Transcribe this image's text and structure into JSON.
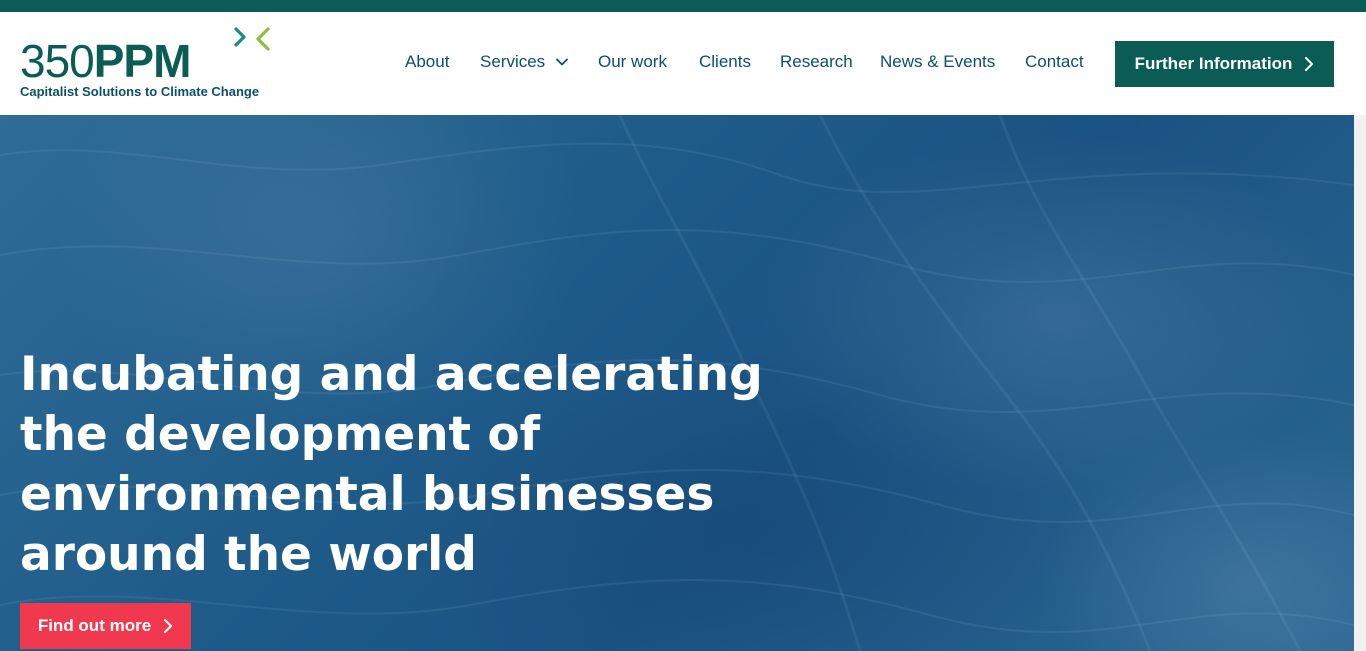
{
  "brand": {
    "logo_number": "350",
    "logo_letters": "PPM",
    "tagline": "Capitalist Solutions to Climate Change",
    "colors": {
      "primary": "#0b5c55",
      "accent_green": "#8cbf3f",
      "accent_teal": "#1c8a86",
      "nav_text": "#0b4f6c",
      "cta_red": "#f0394f"
    }
  },
  "nav": {
    "items": [
      {
        "label": "About"
      },
      {
        "label": "Services",
        "icon": "chevron-down-icon"
      },
      {
        "label": "Our work"
      },
      {
        "label": "Clients"
      },
      {
        "label": "Research"
      },
      {
        "label": "News & Events"
      },
      {
        "label": "Contact"
      }
    ],
    "cta_label": "Further Information",
    "cta_icon": "chevron-right-icon"
  },
  "hero": {
    "heading": "Incubating and accelerating the development of environmental businesses around the world",
    "cta_label": "Find out more",
    "cta_icon": "chevron-right-icon"
  }
}
